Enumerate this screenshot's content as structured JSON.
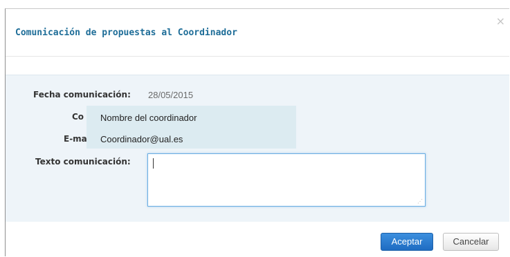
{
  "dialog": {
    "title": "Comunicación de propuestas al Coordinador",
    "close_glyph": "×"
  },
  "form": {
    "fecha_label": "Fecha comunicación:",
    "fecha_value": "28/05/2015",
    "coordinador_label_partial": "Co",
    "email_label_partial": "E-ma",
    "texto_label": "Texto comunicación:",
    "texto_value": ""
  },
  "tooltip": {
    "name": "Nombre del coordinador",
    "email": "Coordinador@ual.es"
  },
  "footer": {
    "accept_label": "Aceptar",
    "cancel_label": "Cancelar"
  },
  "colors": {
    "title": "#1e6d98",
    "body_bg": "#eef4f9",
    "tooltip_bg": "#dcebf1",
    "primary_button": "#2a7bd0"
  },
  "icons": {
    "close": "close-icon",
    "resize": "resize-grip-icon"
  }
}
